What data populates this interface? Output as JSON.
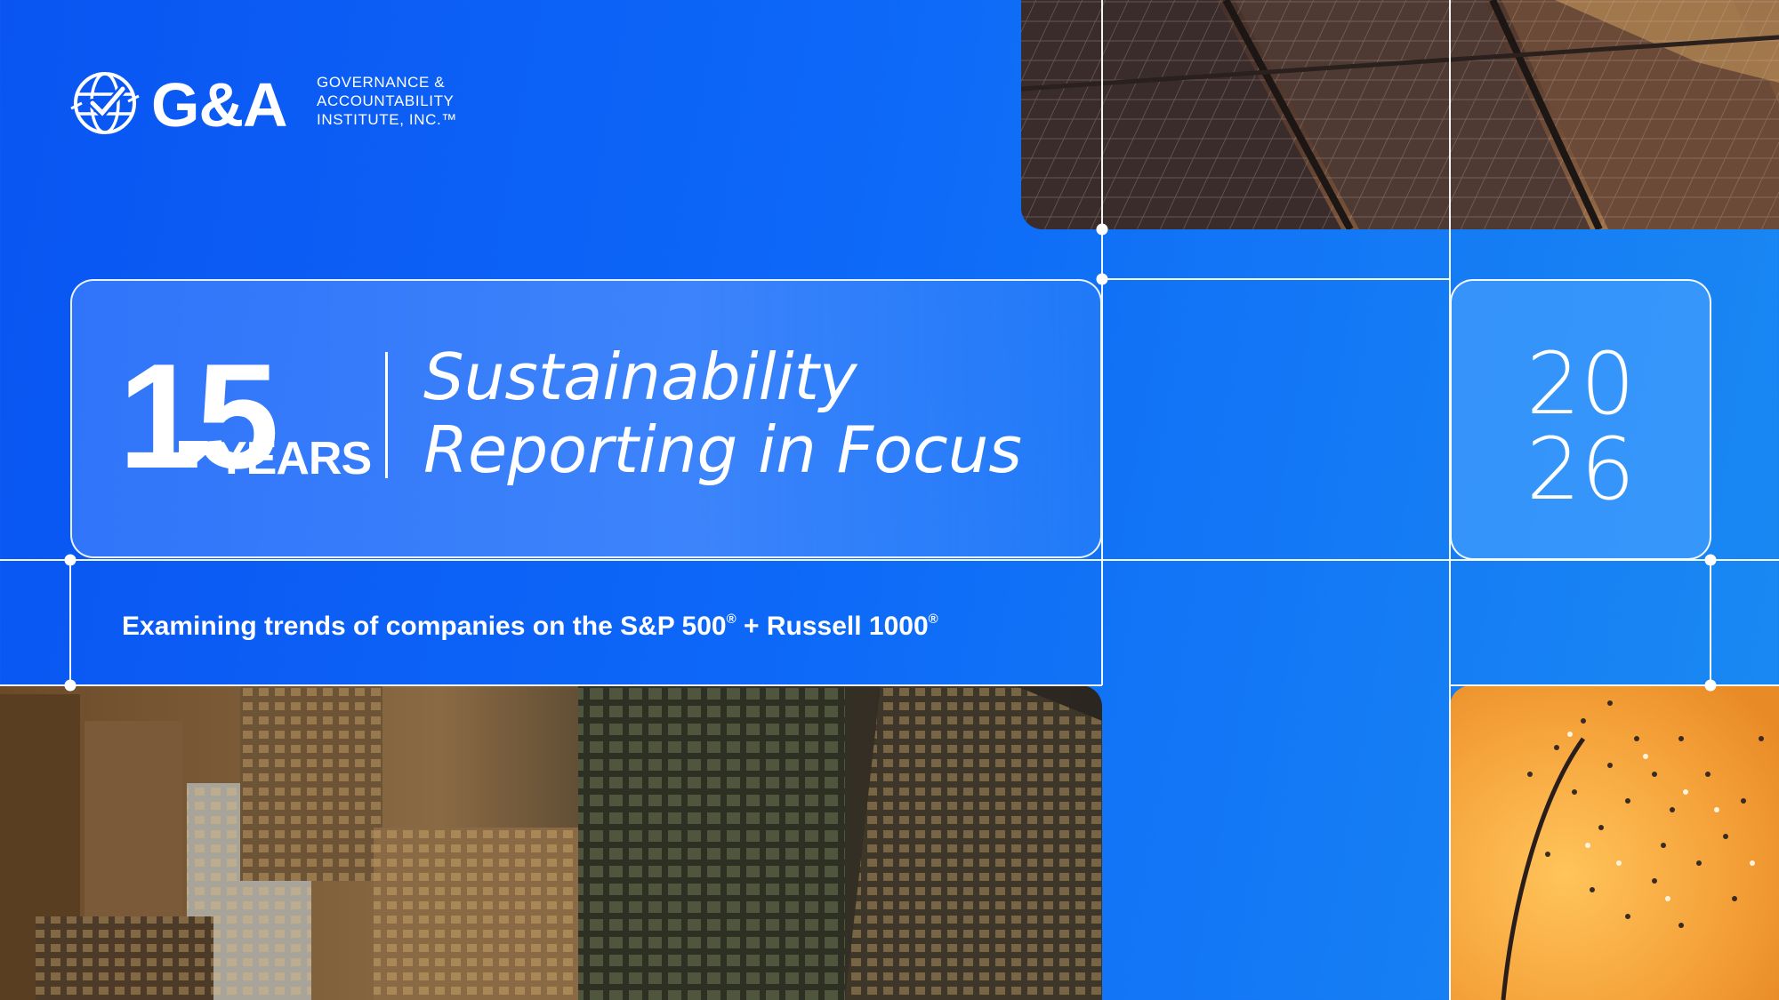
{
  "logo": {
    "wordmark": "G&A",
    "subtitle_lines": [
      "GOVERNANCE &",
      "ACCOUNTABILITY",
      "INSTITUTE, INC.™"
    ]
  },
  "badge": {
    "number": "15",
    "word": "YEARS"
  },
  "title": {
    "line1": "Sustainability",
    "line2": "Reporting in Focus"
  },
  "year": {
    "top": "20",
    "bottom": "26"
  },
  "subtitle": {
    "part1": "Examining trends of companies on the S&P 500",
    "mark1": "®",
    "part2": " + Russell 1000",
    "mark2": "®"
  },
  "colors": {
    "background_start": "#0a55f2",
    "background_end": "#1a8af2",
    "accent_orange": "#f5a23a",
    "text": "#ffffff"
  }
}
